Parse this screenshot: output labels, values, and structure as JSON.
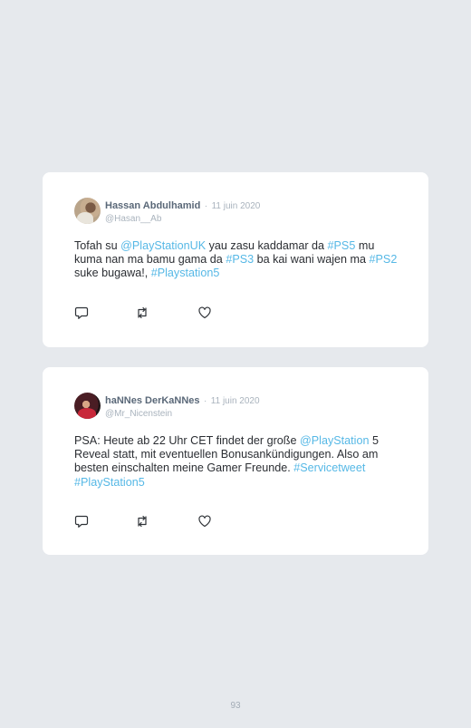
{
  "tweets": [
    {
      "name": "Hassan Abdulhamid",
      "separator": "·",
      "date": "11 juin 2020",
      "handle": "@Hasan__Ab",
      "text_parts": [
        {
          "t": "Tofah su ",
          "link": false
        },
        {
          "t": "@PlayStationUK",
          "link": true
        },
        {
          "t": " yau zasu kaddamar da ",
          "link": false
        },
        {
          "t": "#PS5",
          "link": true
        },
        {
          "t": " mu kuma nan ma bamu gama da ",
          "link": false
        },
        {
          "t": "#PS3",
          "link": true
        },
        {
          "t": " ba kai wani wajen ma ",
          "link": false
        },
        {
          "t": "#PS2",
          "link": true
        },
        {
          "t": " suke bugawa!, ",
          "link": false
        },
        {
          "t": "#Playstation5",
          "link": true
        }
      ],
      "icons": {
        "reply": "reply-icon",
        "retweet": "retweet-icon",
        "like": "like-icon"
      }
    },
    {
      "name": "haNNes DerKaNNes",
      "separator": "·",
      "date": "11 juin 2020",
      "handle": "@Mr_Nicenstein",
      "text_parts": [
        {
          "t": "PSA: Heute ab 22 Uhr CET findet der große ",
          "link": false
        },
        {
          "t": "@PlayStation",
          "link": true
        },
        {
          "t": " 5 Reveal statt, mit eventuellen Bonusankündigungen. Also am besten einschalten meine Gamer Freunde. ",
          "link": false
        },
        {
          "t": "#Servicetweet",
          "link": true
        },
        {
          "t": " ",
          "link": false
        },
        {
          "t": "#PlayStation5",
          "link": true
        }
      ],
      "icons": {
        "reply": "reply-icon",
        "retweet": "retweet-icon",
        "like": "like-icon"
      }
    }
  ],
  "page_number": "93",
  "colors": {
    "background": "#e6e9ed",
    "card": "#ffffff",
    "link": "#56b8e6",
    "name": "#5a6878",
    "muted": "#a9b3bd",
    "text": "#2b2e33"
  }
}
